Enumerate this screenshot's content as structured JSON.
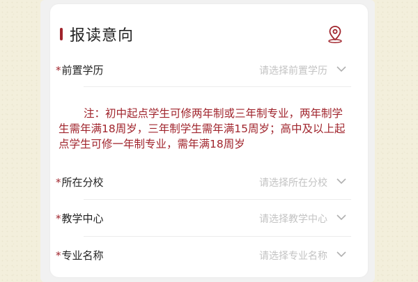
{
  "header": {
    "title": "报读意向",
    "location_icon": "location-pin-icon"
  },
  "fields": [
    {
      "label": "前置学历",
      "placeholder": "请选择前置学历"
    },
    {
      "label": "所在分校",
      "placeholder": "请选择所在分校"
    },
    {
      "label": "教学中心",
      "placeholder": "请选择教学中心"
    },
    {
      "label": "专业名称",
      "placeholder": "请选择专业名称"
    }
  ],
  "required_mark": "*",
  "note": "注：初中起点学生可修两年制或三年制专业，两年制学生需年满18周岁，三年制学生需年满15周岁；高中及以上起点学生可修一年制专业，需年满18周岁",
  "colors": {
    "accent": "#a0242c",
    "placeholder": "#c3c3c3",
    "background": "#f3efdc"
  }
}
